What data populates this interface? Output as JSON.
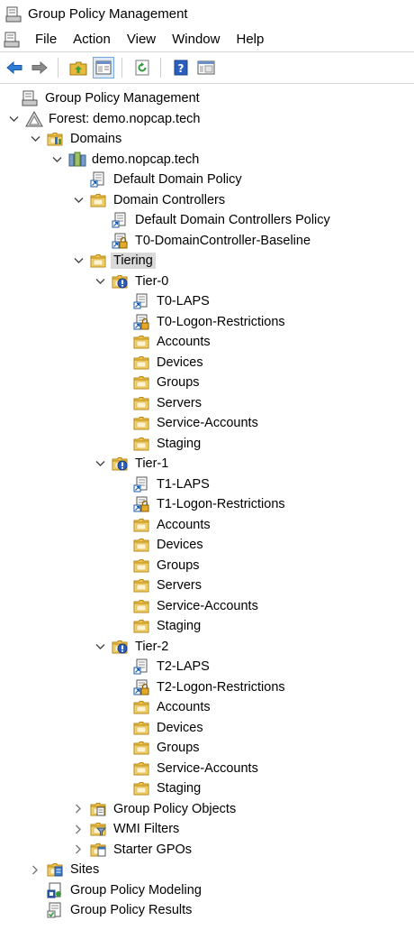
{
  "window": {
    "title": "Group Policy Management"
  },
  "menu": [
    "File",
    "Action",
    "View",
    "Window",
    "Help"
  ],
  "toolbar": [
    "back-icon",
    "forward-icon",
    "up-folder-icon",
    "show-hide-tree-icon",
    "refresh-icon",
    "help-icon",
    "properties-icon"
  ],
  "tree": [
    {
      "label": "Group Policy Management",
      "level": 0,
      "icon": "gpm-icon",
      "expander": "none"
    },
    {
      "label": "Forest: demo.nopcap.tech",
      "level": 1,
      "icon": "forest-icon",
      "expander": "expanded"
    },
    {
      "label": "Domains",
      "level": 2,
      "icon": "domains-icon",
      "expander": "expanded"
    },
    {
      "label": "demo.nopcap.tech",
      "level": 3,
      "icon": "domain-icon",
      "expander": "expanded"
    },
    {
      "label": "Default Domain Policy",
      "level": 4,
      "icon": "gpo-link-icon",
      "expander": "none"
    },
    {
      "label": "Domain Controllers",
      "level": 4,
      "icon": "ou-icon",
      "expander": "expanded"
    },
    {
      "label": "Default Domain Controllers Policy",
      "level": 5,
      "icon": "gpo-link-icon",
      "expander": "none"
    },
    {
      "label": "T0-DomainController-Baseline",
      "level": 5,
      "icon": "gpo-link-enforced-icon",
      "expander": "none"
    },
    {
      "label": "Tiering",
      "level": 4,
      "icon": "ou-icon",
      "expander": "expanded",
      "selected": true
    },
    {
      "label": "Tier-0",
      "level": 5,
      "icon": "ou-blocked-icon",
      "expander": "expanded"
    },
    {
      "label": "T0-LAPS",
      "level": 6,
      "icon": "gpo-link-icon",
      "expander": "none"
    },
    {
      "label": "T0-Logon-Restrictions",
      "level": 6,
      "icon": "gpo-link-enforced-icon",
      "expander": "none"
    },
    {
      "label": "Accounts",
      "level": 6,
      "icon": "ou-icon",
      "expander": "none"
    },
    {
      "label": "Devices",
      "level": 6,
      "icon": "ou-icon",
      "expander": "none"
    },
    {
      "label": "Groups",
      "level": 6,
      "icon": "ou-icon",
      "expander": "none"
    },
    {
      "label": "Servers",
      "level": 6,
      "icon": "ou-icon",
      "expander": "none"
    },
    {
      "label": "Service-Accounts",
      "level": 6,
      "icon": "ou-icon",
      "expander": "none"
    },
    {
      "label": "Staging",
      "level": 6,
      "icon": "ou-icon",
      "expander": "none"
    },
    {
      "label": "Tier-1",
      "level": 5,
      "icon": "ou-blocked-icon",
      "expander": "expanded"
    },
    {
      "label": "T1-LAPS",
      "level": 6,
      "icon": "gpo-link-icon",
      "expander": "none"
    },
    {
      "label": "T1-Logon-Restrictions",
      "level": 6,
      "icon": "gpo-link-enforced-icon",
      "expander": "none"
    },
    {
      "label": "Accounts",
      "level": 6,
      "icon": "ou-icon",
      "expander": "none"
    },
    {
      "label": "Devices",
      "level": 6,
      "icon": "ou-icon",
      "expander": "none"
    },
    {
      "label": "Groups",
      "level": 6,
      "icon": "ou-icon",
      "expander": "none"
    },
    {
      "label": "Servers",
      "level": 6,
      "icon": "ou-icon",
      "expander": "none"
    },
    {
      "label": "Service-Accounts",
      "level": 6,
      "icon": "ou-icon",
      "expander": "none"
    },
    {
      "label": "Staging",
      "level": 6,
      "icon": "ou-icon",
      "expander": "none"
    },
    {
      "label": "Tier-2",
      "level": 5,
      "icon": "ou-blocked-icon",
      "expander": "expanded"
    },
    {
      "label": "T2-LAPS",
      "level": 6,
      "icon": "gpo-link-icon",
      "expander": "none"
    },
    {
      "label": "T2-Logon-Restrictions",
      "level": 6,
      "icon": "gpo-link-enforced-icon",
      "expander": "none"
    },
    {
      "label": "Accounts",
      "level": 6,
      "icon": "ou-icon",
      "expander": "none"
    },
    {
      "label": "Devices",
      "level": 6,
      "icon": "ou-icon",
      "expander": "none"
    },
    {
      "label": "Groups",
      "level": 6,
      "icon": "ou-icon",
      "expander": "none"
    },
    {
      "label": "Service-Accounts",
      "level": 6,
      "icon": "ou-icon",
      "expander": "none"
    },
    {
      "label": "Staging",
      "level": 6,
      "icon": "ou-icon",
      "expander": "none"
    },
    {
      "label": "Group Policy Objects",
      "level": 4,
      "icon": "gpo-container-icon",
      "expander": "collapsed"
    },
    {
      "label": "WMI Filters",
      "level": 4,
      "icon": "wmi-filter-icon",
      "expander": "collapsed"
    },
    {
      "label": "Starter GPOs",
      "level": 4,
      "icon": "starter-gpo-icon",
      "expander": "collapsed"
    },
    {
      "label": "Sites",
      "level": 2,
      "icon": "sites-icon",
      "expander": "collapsed"
    },
    {
      "label": "Group Policy Modeling",
      "level": 2,
      "icon": "gp-modeling-icon",
      "expander": "none"
    },
    {
      "label": "Group Policy Results",
      "level": 2,
      "icon": "gp-results-icon",
      "expander": "none"
    }
  ]
}
